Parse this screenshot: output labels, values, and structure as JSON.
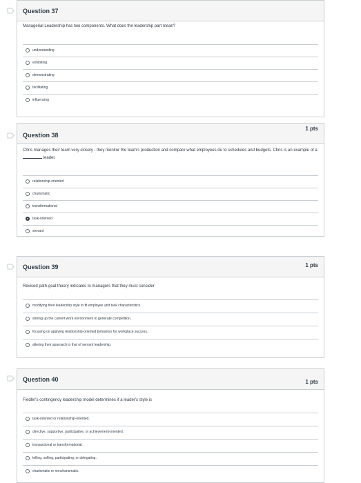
{
  "questions": [
    {
      "title": "Question 37",
      "points": "",
      "prompt": "Managerial Leadership has two components. What does the leadership part mean?",
      "options": [
        "understanding",
        "exhibiting",
        "demonstrating",
        "facilitating",
        "influencing"
      ],
      "selected": null
    },
    {
      "title": "Question 38",
      "points": "1 pts",
      "prompt_before": "Chris manages their team very closely - they monitor the team's production and compare what employees do to schedules and budgets. Chris is an example of a",
      "prompt_after": "leader.",
      "options": [
        "relationship-oriented",
        "charismatic",
        "transformational",
        "task-oriented",
        "servant"
      ],
      "selected": 3
    },
    {
      "title": "Question 39",
      "points": "1 pts",
      "prompt": "Revised path-goal theory indicates to managers that they must consider",
      "options": [
        "modifying their leadership style to fit employee and task characteristics.",
        "stirring up the current work environment to generate competition.",
        "focusing on applying relationship-oriented behaviors for workplace success.",
        "altering their approach to that of servant leadership."
      ],
      "selected": null
    },
    {
      "title": "Question 40",
      "points": "1 pts",
      "prompt": "Fiedler's contingency leadership model determines if a leader's style is",
      "options": [
        "task-oriented or relationship-oriented.",
        "directive, supportive, participative, or achievement-oriented.",
        "transactional or transformational.",
        "telling, selling, participating, or delegating.",
        "charismatic or noncharismatic."
      ],
      "selected": null
    }
  ]
}
